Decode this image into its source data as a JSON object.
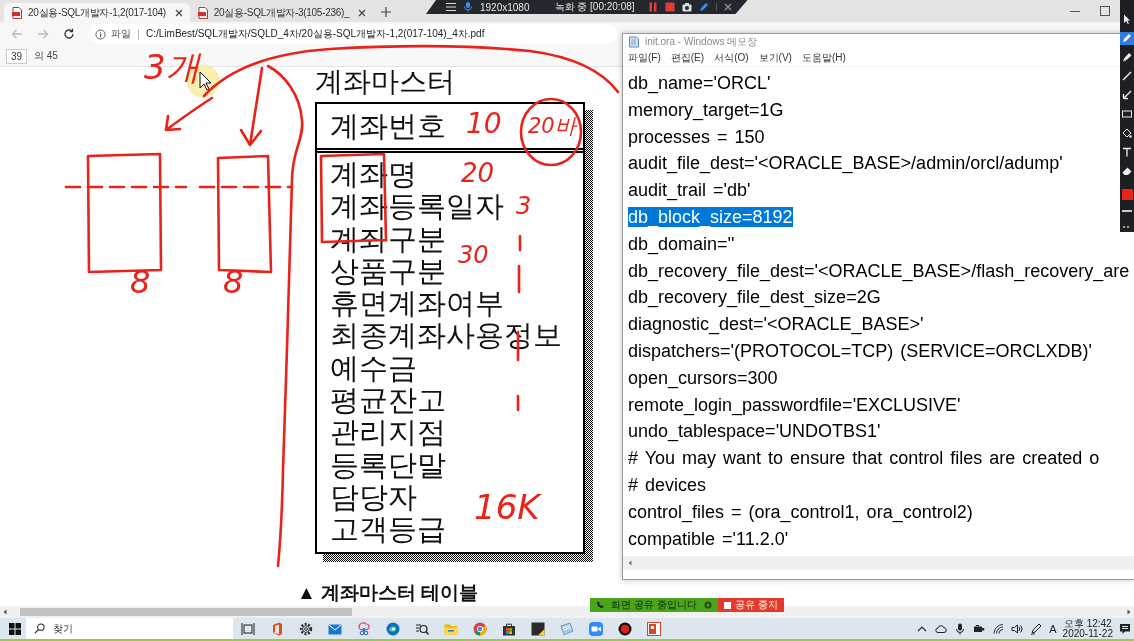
{
  "browser": {
    "tabs": [
      {
        "title": "20실용-SQL개발자-1,2(017-104)",
        "selected": true
      },
      {
        "title": "20실용-SQL개발자-3(105-236)_",
        "selected": false
      }
    ],
    "address_bar": {
      "scheme_label": "파일",
      "url": "C:/LimBest/SQL개발자/SQLD_4차/20실용-SQL개발자-1,2(017-104)_4차.pdf"
    }
  },
  "recorder": {
    "resolution": "1920x1080",
    "status": "녹화 중 [00:20:08]"
  },
  "pen_toolbar": {
    "tools": [
      {
        "kind": "cursor",
        "selected": false
      },
      {
        "kind": "pen",
        "selected": true
      },
      {
        "kind": "marker",
        "selected": false
      },
      {
        "kind": "line",
        "selected": false
      },
      {
        "kind": "arrow",
        "selected": false
      },
      {
        "kind": "rectangle",
        "selected": false
      },
      {
        "kind": "fill",
        "selected": false
      },
      {
        "kind": "text",
        "selected": false
      },
      {
        "kind": "eraser",
        "selected": false
      }
    ]
  },
  "pdf": {
    "page": "39",
    "page_total": "의 45",
    "document": {
      "title": "계좌마스터",
      "key_field": "계좌번호",
      "fields": [
        "계좌명",
        "계좌등록일자",
        "계좌구분",
        "상품구분",
        "휴면계좌여부",
        "최종계좌사용정보",
        "예수금",
        "평균잔고",
        "관리지점",
        "등록단말",
        "담당자",
        "고객등급"
      ],
      "caption": "▲ 계좌마스터 테이블"
    },
    "annotations": [
      {
        "text": "3개"
      },
      {
        "text": "10"
      },
      {
        "text": "20바"
      },
      {
        "text": "20"
      },
      {
        "text": "3"
      },
      {
        "text": "30"
      },
      {
        "text": "8"
      },
      {
        "text": "8"
      },
      {
        "text": "16K"
      }
    ]
  },
  "notepad": {
    "title": "init.ora - Windows 메모장",
    "menu": [
      "파일(F)",
      "편집(E)",
      "서식(O)",
      "보기(V)",
      "도움말(H)"
    ],
    "lines": [
      {
        "text": "db_name='ORCL'",
        "selected": false
      },
      {
        "text": "memory_target=1G",
        "selected": false
      },
      {
        "text": "processes = 150",
        "selected": false
      },
      {
        "text": "audit_file_dest='<ORACLE_BASE>/admin/orcl/adump'",
        "selected": false
      },
      {
        "text": "audit_trail ='db'",
        "selected": false
      },
      {
        "text": "db_block_size=8192",
        "selected": true
      },
      {
        "text": "db_domain=''",
        "selected": false
      },
      {
        "text": "db_recovery_file_dest='<ORACLE_BASE>/flash_recovery_are",
        "selected": false
      },
      {
        "text": "db_recovery_file_dest_size=2G",
        "selected": false
      },
      {
        "text": "diagnostic_dest='<ORACLE_BASE>'",
        "selected": false
      },
      {
        "text": "dispatchers='(PROTOCOL=TCP) (SERVICE=ORCLXDB)'",
        "selected": false
      },
      {
        "text": "open_cursors=300",
        "selected": false
      },
      {
        "text": "remote_login_passwordfile='EXCLUSIVE'",
        "selected": false
      },
      {
        "text": "undo_tablespace='UNDOTBS1'",
        "selected": false
      },
      {
        "text": "# You may want to ensure that control files are created o",
        "selected": false
      },
      {
        "text": "# devices",
        "selected": false
      },
      {
        "text": "control_files = (ora_control1, ora_control2)",
        "selected": false
      },
      {
        "text": "compatible ='11.2.0'",
        "selected": false
      }
    ]
  },
  "screen_share": {
    "status": "화면 공유 중입니다",
    "stop_label": "공유 중지"
  },
  "taskbar": {
    "search_placeholder": "찾기",
    "input_mode": "A",
    "time": "오후 12:42",
    "date": "2020-11-22"
  }
}
